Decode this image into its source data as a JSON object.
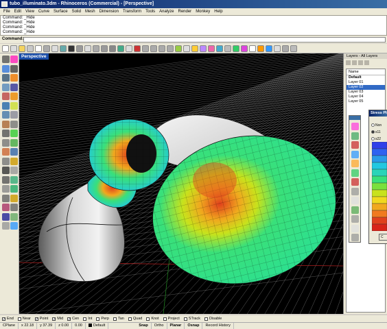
{
  "window": {
    "title": "tubo_illuminato.3dm - Rhinoceros (Commercial) - [Perspective]"
  },
  "menu": [
    "File",
    "Edit",
    "View",
    "Curve",
    "Surface",
    "Solid",
    "Mesh",
    "Dimension",
    "Transform",
    "Tools",
    "Analyze",
    "Render",
    "Monkey",
    "Help"
  ],
  "command_history": [
    "Command: _Hide",
    "Command: _Hide",
    "Command: _Hide",
    "Command: _Hide"
  ],
  "command_prompt": "Command:",
  "viewport": {
    "label": "Perspective"
  },
  "layers_panel": {
    "title": "Layers - All Layers",
    "column_header": "Name",
    "rows": [
      "Default",
      "Layer 01",
      "Layer 02",
      "Layer 03",
      "Layer 04",
      "Layer 05"
    ],
    "selected_index": 2
  },
  "stress_dialog": {
    "title": "Stress Plot",
    "options": [
      "Non",
      "s11",
      "s22"
    ],
    "selected_option": 1,
    "button_label": "C"
  },
  "osnap": [
    {
      "label": "End",
      "checked": true
    },
    {
      "label": "Near",
      "checked": false
    },
    {
      "label": "Point",
      "checked": true
    },
    {
      "label": "Mid",
      "checked": true
    },
    {
      "label": "Cen",
      "checked": true
    },
    {
      "label": "Int",
      "checked": false
    },
    {
      "label": "Perp",
      "checked": false
    },
    {
      "label": "Tan",
      "checked": false
    },
    {
      "label": "Quad",
      "checked": false
    },
    {
      "label": "Knot",
      "checked": false
    },
    {
      "label": "Project",
      "checked": false
    },
    {
      "label": "STrack",
      "checked": false
    },
    {
      "label": "Disable",
      "checked": false
    }
  ],
  "status": {
    "cplane": "CPlane",
    "x": "x 22.18",
    "y": "y 37.39",
    "z": "z 0.00",
    "units": "0.00",
    "layer": "Default",
    "snap": "Snap",
    "ortho": "Ortho",
    "planar": "Planar",
    "osnap": "Osnap",
    "record": "Record History"
  },
  "colors": {
    "accent": "#316ac5",
    "viewport_bg": "#000000",
    "grid": "#ffffff"
  },
  "scene": {
    "objects": [
      "grey-bulb-tube",
      "grey-bell-tube",
      "stress-ring",
      "stress-neck",
      "stress-flared-horn"
    ],
    "stress_colors": [
      "#1a3bd8",
      "#22c8e0",
      "#39e07a",
      "#c8e21c",
      "#f0a81e",
      "#e0401c"
    ]
  }
}
